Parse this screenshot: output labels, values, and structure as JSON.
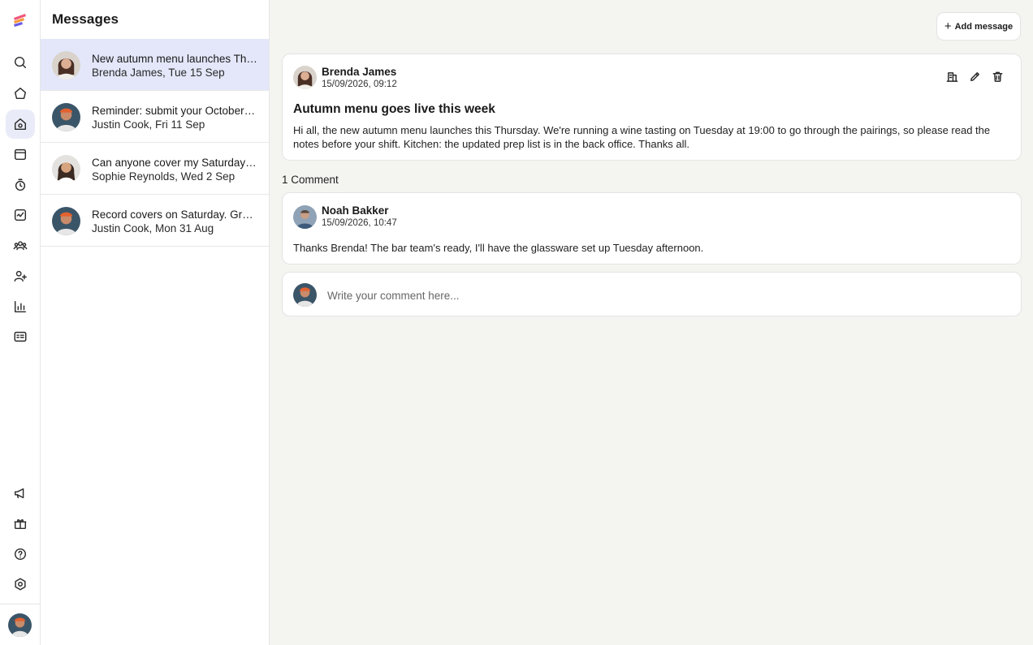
{
  "sidebar": {
    "logo": "app-logo",
    "nav_icons": [
      "search-icon",
      "home-icon",
      "messages-icon",
      "calendar-icon",
      "timer-icon",
      "tasks-icon",
      "team-icon",
      "add-user-icon",
      "reports-icon",
      "forms-icon"
    ],
    "active": "messages-icon",
    "bottom_icons": [
      "announcement-icon",
      "gift-icon",
      "help-icon",
      "settings-icon"
    ]
  },
  "messages": {
    "title": "Messages",
    "items": [
      {
        "title": "New autumn menu launches Thursday",
        "meta": "Brenda James, Tue 15 Sep"
      },
      {
        "title": "Reminder: submit your October availability",
        "meta": "Justin Cook, Fri 11 Sep"
      },
      {
        "title": "Can anyone cover my Saturday close?",
        "meta": "Sophie Reynolds, Wed 2 Sep"
      },
      {
        "title": "Record covers on Saturday. Great work everyone",
        "meta": "Justin Cook, Mon 31 Aug"
      }
    ]
  },
  "toolbar": {
    "add_label": "Add message"
  },
  "post": {
    "author": "Brenda James",
    "date": "15/09/2026, 09:12",
    "title": "Autumn menu goes live this week",
    "body": "Hi all, the new autumn menu launches this Thursday. We're running a wine tasting on Tuesday at 19:00 to go through the pairings, so please read the notes before your shift. Kitchen: the updated prep list is in the back office. Thanks all."
  },
  "comments": {
    "count_label": "1 Comment",
    "items": [
      {
        "author": "Noah Bakker",
        "date": "15/09/2026, 10:47",
        "body": "Thanks Brenda! The bar team's ready, I'll have the glassware set up Tuesday afternoon."
      }
    ]
  },
  "compose": {
    "placeholder": "Write your comment here..."
  },
  "colors": {
    "selected_bg": "#e3e7f9",
    "app_bg": "#f4f4f1",
    "active_nav_bg": "#e9ecf8"
  }
}
